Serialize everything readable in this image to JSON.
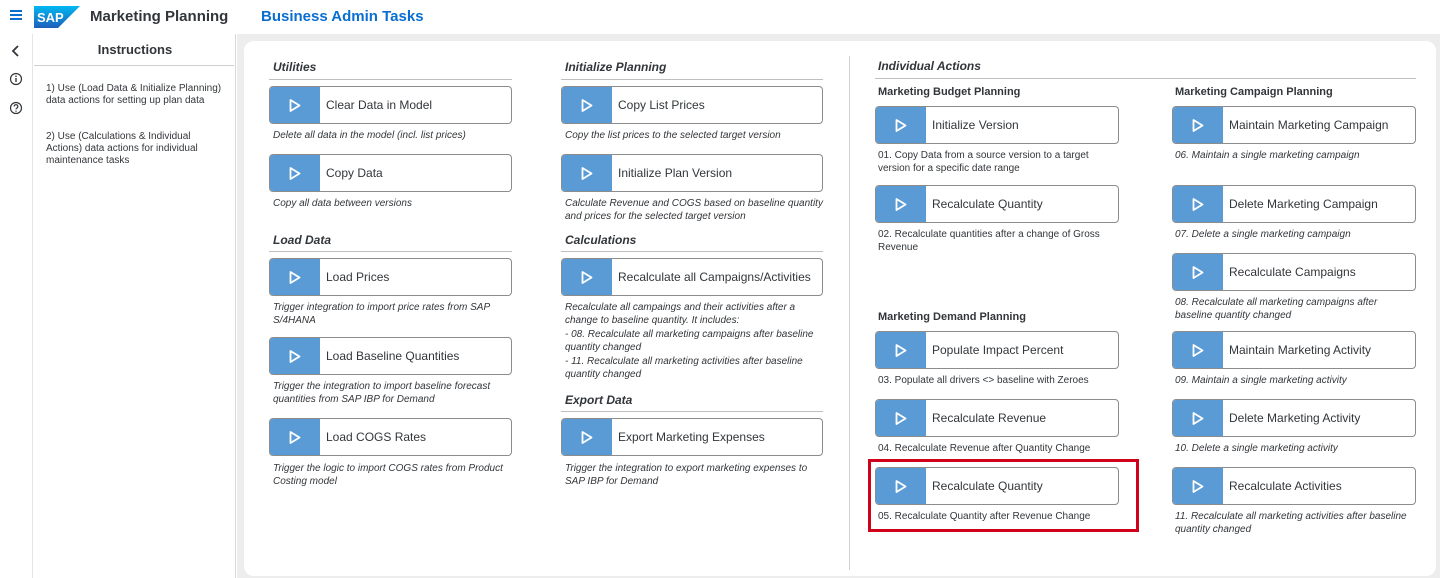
{
  "header": {
    "app_title": "Marketing Planning",
    "page_title": "Business Admin Tasks",
    "logo_text": "SAP"
  },
  "rail": {
    "icons": [
      "chevron-left-icon",
      "info-icon",
      "help-icon"
    ]
  },
  "instructions": {
    "title": "Instructions",
    "items": [
      "1) Use (Load Data & Initialize Planning) data actions for setting up plan data",
      "2) Use (Calculations & Individual Actions) data actions for individual maintenance tasks"
    ]
  },
  "sections": {
    "utilities": {
      "title": "Utilities",
      "buttons": [
        {
          "label": "Clear Data in Model",
          "desc": "Delete all data in the model (incl. list prices)"
        },
        {
          "label": "Copy Data",
          "desc": "Copy all data between versions"
        }
      ]
    },
    "load_data": {
      "title": "Load Data",
      "buttons": [
        {
          "label": "Load Prices",
          "desc": "Trigger integration to import price rates from SAP S/4HANA"
        },
        {
          "label": "Load Baseline Quantities",
          "desc": "Trigger the integration to import baseline forecast quantities from SAP IBP for Demand"
        },
        {
          "label": "Load COGS Rates",
          "desc": "Trigger the logic to import COGS rates from Product Costing model"
        }
      ]
    },
    "initialize_planning": {
      "title": "Initialize Planning",
      "buttons": [
        {
          "label": "Copy List Prices",
          "desc": "Copy the list prices to the selected target version"
        },
        {
          "label": "Initialize Plan Version",
          "desc": "Calculate Revenue and COGS based on baseline quantity and prices for the selected target version"
        }
      ]
    },
    "calculations": {
      "title": "Calculations",
      "buttons": [
        {
          "label": "Recalculate all Campaigns/Activities",
          "desc_lines": [
            "Recalculate all campaings and their activities after a change to baseline quantity. It includes:",
            "- 08. Recalculate all marketing campaigns after baseline quantity changed",
            "- 11. Recalculate all marketing activities after baseline quantity changed"
          ]
        }
      ]
    },
    "export_data": {
      "title": "Export Data",
      "buttons": [
        {
          "label": "Export Marketing Expenses",
          "desc": "Trigger the integration to export marketing expenses to SAP IBP for Demand"
        }
      ]
    },
    "individual_actions": {
      "title": "Individual Actions",
      "budget": {
        "title": "Marketing Budget Planning",
        "buttons": [
          {
            "label": "Initialize Version",
            "desc": "01. Copy Data from a source version to a target version for a specific date range"
          },
          {
            "label": "Recalculate Quantity",
            "desc": "02. Recalculate quantities after a change of Gross Revenue"
          }
        ]
      },
      "demand": {
        "title": "Marketing Demand Planning",
        "buttons": [
          {
            "label": "Populate Impact Percent",
            "desc": "03. Populate all drivers <> baseline with Zeroes"
          },
          {
            "label": "Recalculate Revenue",
            "desc": "04. Recalculate Revenue after Quantity Change"
          },
          {
            "label": "Recalculate Quantity",
            "desc": "05. Recalculate Quantity after Revenue Change"
          }
        ]
      },
      "campaign": {
        "title": "Marketing Campaign Planning",
        "buttons": [
          {
            "label": "Maintain Marketing Campaign",
            "desc": "06. Maintain a single marketing campaign"
          },
          {
            "label": "Delete Marketing Campaign",
            "desc": "07. Delete a single marketing campaign"
          },
          {
            "label": "Recalculate Campaigns",
            "desc": "08. Recalculate all marketing campaigns after baseline quantity changed"
          },
          {
            "label": "Maintain Marketing Activity",
            "desc": "09. Maintain a single marketing activity"
          },
          {
            "label": "Delete Marketing Activity",
            "desc": "10. Delete a single marketing activity"
          },
          {
            "label": "Recalculate Activities",
            "desc": "11. Recalculate all marketing activities after baseline quantity changed"
          }
        ]
      }
    }
  },
  "colors": {
    "accent": "#0a6ed1",
    "play_button": "#5a9bd5",
    "highlight": "#d0021b"
  }
}
